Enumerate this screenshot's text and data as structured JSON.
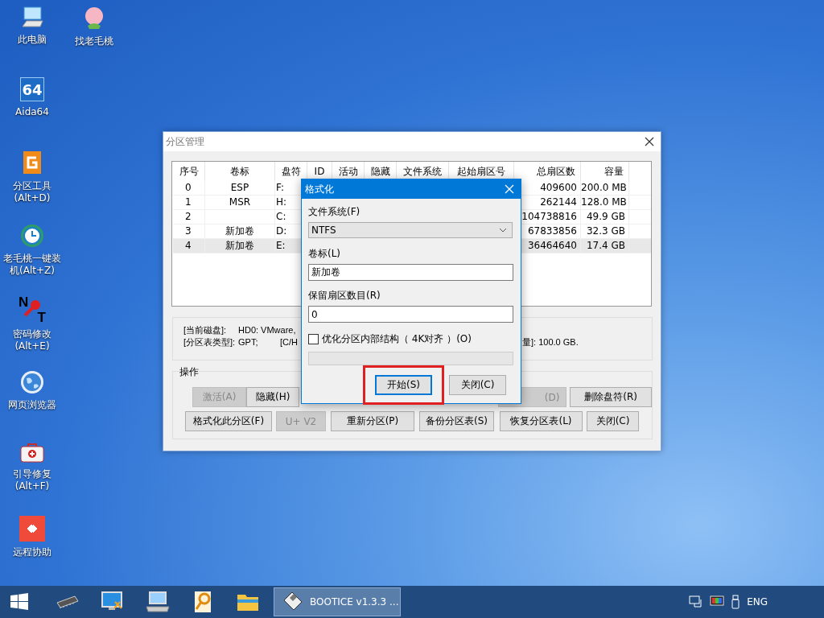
{
  "desktop_icons": [
    {
      "kind": "computer",
      "lines": [
        "此电脑"
      ]
    },
    {
      "kind": "peach",
      "lines": [
        "找老毛桃"
      ]
    },
    {
      "kind": "aida",
      "glyph": "64",
      "lines": [
        "Aida64"
      ]
    },
    {
      "kind": "partition",
      "lines": [
        "分区工具",
        "(Alt+D)"
      ]
    },
    {
      "kind": "restore",
      "lines": [
        "老毛桃一键装",
        "机(Alt+Z)"
      ]
    },
    {
      "kind": "key",
      "glyphs": [
        "N",
        "T"
      ],
      "lines": [
        "密码修改",
        "(Alt+E)"
      ]
    },
    {
      "kind": "globe",
      "lines": [
        "网页浏览器"
      ]
    },
    {
      "kind": "firstaid",
      "lines": [
        "引导修复",
        "(Alt+F)"
      ]
    },
    {
      "kind": "remote",
      "lines": [
        "远程协助"
      ]
    }
  ],
  "partition_window": {
    "title": "分区管理",
    "table": {
      "columns": [
        "序号",
        "卷标",
        "盘符",
        "ID",
        "活动",
        "隐藏",
        "文件系统",
        "起始扇区号",
        "总扇区数",
        "容量"
      ],
      "rows": [
        {
          "index": "0",
          "volume_label": "ESP",
          "drive_letter": "F:",
          "total_sectors": "409600",
          "capacity": "200.0 MB",
          "selected": false
        },
        {
          "index": "1",
          "volume_label": "MSR",
          "drive_letter": "H:",
          "total_sectors": "262144",
          "capacity": "128.0 MB",
          "selected": false
        },
        {
          "index": "2",
          "drive_letter": "C:",
          "total_sectors": "104738816",
          "capacity": "49.9 GB",
          "selected": false
        },
        {
          "index": "3",
          "volume_label": "新加卷",
          "drive_letter": "D:",
          "total_sectors": "67833856",
          "capacity": "32.3 GB",
          "selected": false
        },
        {
          "index": "4",
          "volume_label": "新加卷",
          "drive_letter": "E:",
          "total_sectors": "36464640",
          "capacity": "17.4 GB",
          "selected": true
        }
      ]
    },
    "info": [
      {
        "label": "[当前磁盘]:",
        "value": "HD0: VMware,"
      },
      {
        "label": "[分区表类型]:",
        "value": "GPT;",
        "extra": "[C/H",
        "tail": "量]: 100.0 GB."
      }
    ],
    "group_title": "操作",
    "button_rows": [
      [
        {
          "label": "激活(A)",
          "disabled": true
        },
        {
          "label": "隐藏(H)",
          "disabled": false
        },
        {
          "label": "(D)",
          "disabled": true
        },
        {
          "label": "删除盘符(R)",
          "disabled": false
        }
      ],
      [
        {
          "label": "格式化此分区(F)",
          "disabled": false
        },
        {
          "label": "U+ V2",
          "disabled": true
        },
        {
          "label": "重新分区(P)",
          "disabled": false
        },
        {
          "label": "备份分区表(S)",
          "disabled": false
        },
        {
          "label": "恢复分区表(L)",
          "disabled": false
        },
        {
          "label": "关闭(C)",
          "disabled": false
        }
      ]
    ]
  },
  "format_dialog": {
    "title": "格式化",
    "file_system": {
      "label": "文件系统(F)",
      "value": "NTFS"
    },
    "volume_label": {
      "label": "卷标(L)",
      "value": "新加卷"
    },
    "reserved_sectors": {
      "label": "保留扇区数目(R)",
      "value": "0"
    },
    "optimize": {
      "label": "优化分区内部结构（ 4K对齐 ）(O)",
      "checked": false
    },
    "progress": {
      "level": 0
    },
    "buttons": [
      {
        "label": "开始(S)",
        "default": true,
        "highlighted": true
      },
      {
        "label": "关闭(C)",
        "default": false,
        "highlighted": false
      }
    ]
  },
  "taskbar": {
    "items": [
      {
        "kind": "chip",
        "active": false
      },
      {
        "kind": "monitor",
        "active": false
      },
      {
        "kind": "terminal",
        "active": false
      },
      {
        "kind": "magnifier",
        "active": false
      },
      {
        "kind": "folder",
        "active": false
      },
      {
        "kind": "floppy",
        "label": "BOOTICE v1.3.3 ...",
        "active": true
      }
    ],
    "language": "ENG"
  }
}
